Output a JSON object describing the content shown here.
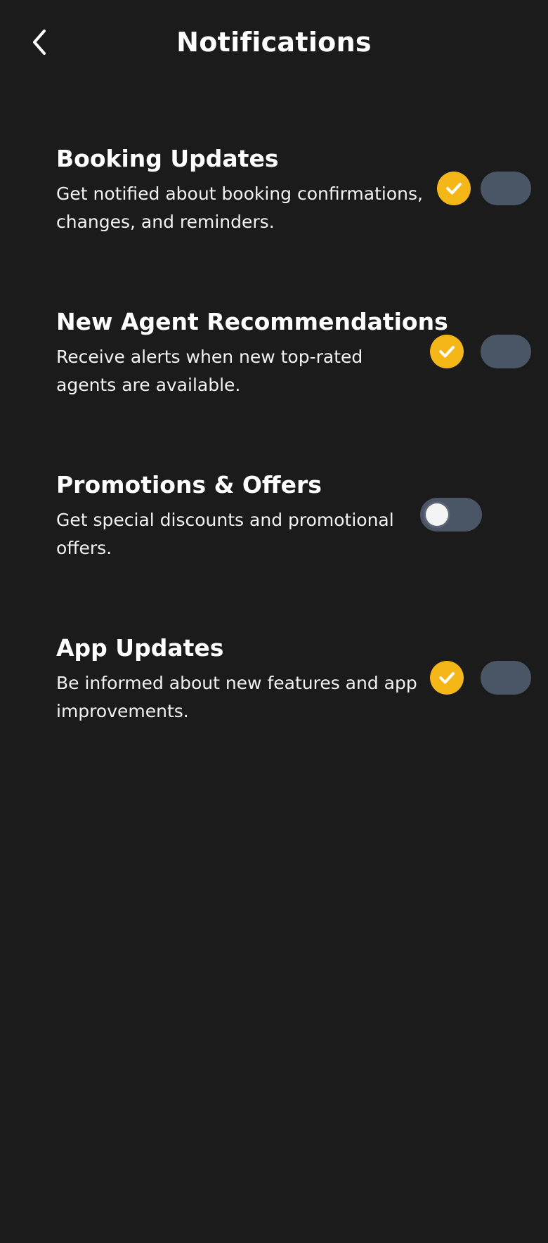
{
  "header": {
    "title": "Notifications",
    "back_icon": "chevron-left-icon"
  },
  "settings": [
    {
      "title": "Booking Updates",
      "description_line1": "Get notified about booking confirmations,",
      "description_line2": "changes, and reminders.",
      "enabled": true
    },
    {
      "title": "New Agent Recommendations",
      "description_line1": "Receive alerts when new top-rated",
      "description_line2": "agents are available.",
      "enabled": true
    },
    {
      "title": "Promotions & Offers",
      "description_line1": "Get special discounts and promotional",
      "description_line2": "offers.",
      "enabled": false
    },
    {
      "title": "App Updates",
      "description_line1": "Be informed about new features and app",
      "description_line2": "improvements.",
      "enabled": true
    }
  ],
  "colors": {
    "background": "#1b1b1b",
    "accent": "#f5b718",
    "toggle_track": "#4a5566",
    "text": "#ffffff"
  }
}
